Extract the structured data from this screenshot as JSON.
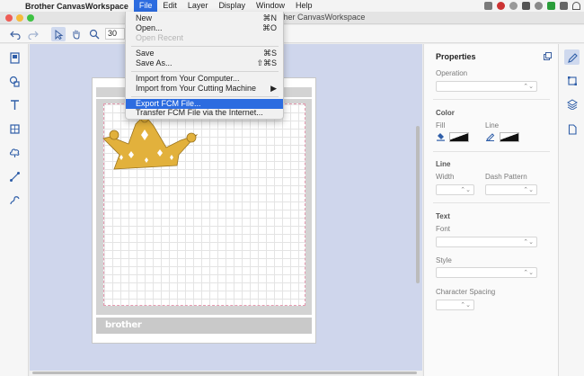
{
  "menubar": {
    "app_name": "Brother CanvasWorkspace",
    "menus": [
      "File",
      "Edit",
      "Layer",
      "Display",
      "Window",
      "Help"
    ],
    "active_menu": "File"
  },
  "window": {
    "title_partial": "other CanvasWorkspace"
  },
  "toolbar": {
    "zoom_value": "30"
  },
  "file_menu": {
    "items": [
      {
        "label": "New",
        "shortcut": "⌘N"
      },
      {
        "label": "Open...",
        "shortcut": "⌘O"
      },
      {
        "label": "Open Recent",
        "shortcut": ""
      },
      {
        "label": "Save",
        "shortcut": "⌘S"
      },
      {
        "label": "Save As...",
        "shortcut": "⇧⌘S"
      },
      {
        "label": "Import from Your Computer...",
        "shortcut": ""
      },
      {
        "label": "Import from Your Cutting Machine",
        "shortcut": "▶"
      },
      {
        "label": "Export FCM File...",
        "shortcut": ""
      },
      {
        "label": "Transfer FCM File via the Internet...",
        "shortcut": ""
      }
    ]
  },
  "canvas": {
    "mat_brand": "brother",
    "crown_color": "#e2b13c"
  },
  "properties": {
    "title": "Properties",
    "operation_label": "Operation",
    "color_header": "Color",
    "fill_label": "Fill",
    "line_label": "Line",
    "line_header": "Line",
    "width_label": "Width",
    "dash_label": "Dash Pattern",
    "text_header": "Text",
    "font_label": "Font",
    "style_label": "Style",
    "spacing_label": "Character Spacing"
  },
  "colors": {
    "accent": "#2c6ce0",
    "canvas_bg": "#cfd6ec",
    "icon_blue": "#2f5ea8"
  }
}
